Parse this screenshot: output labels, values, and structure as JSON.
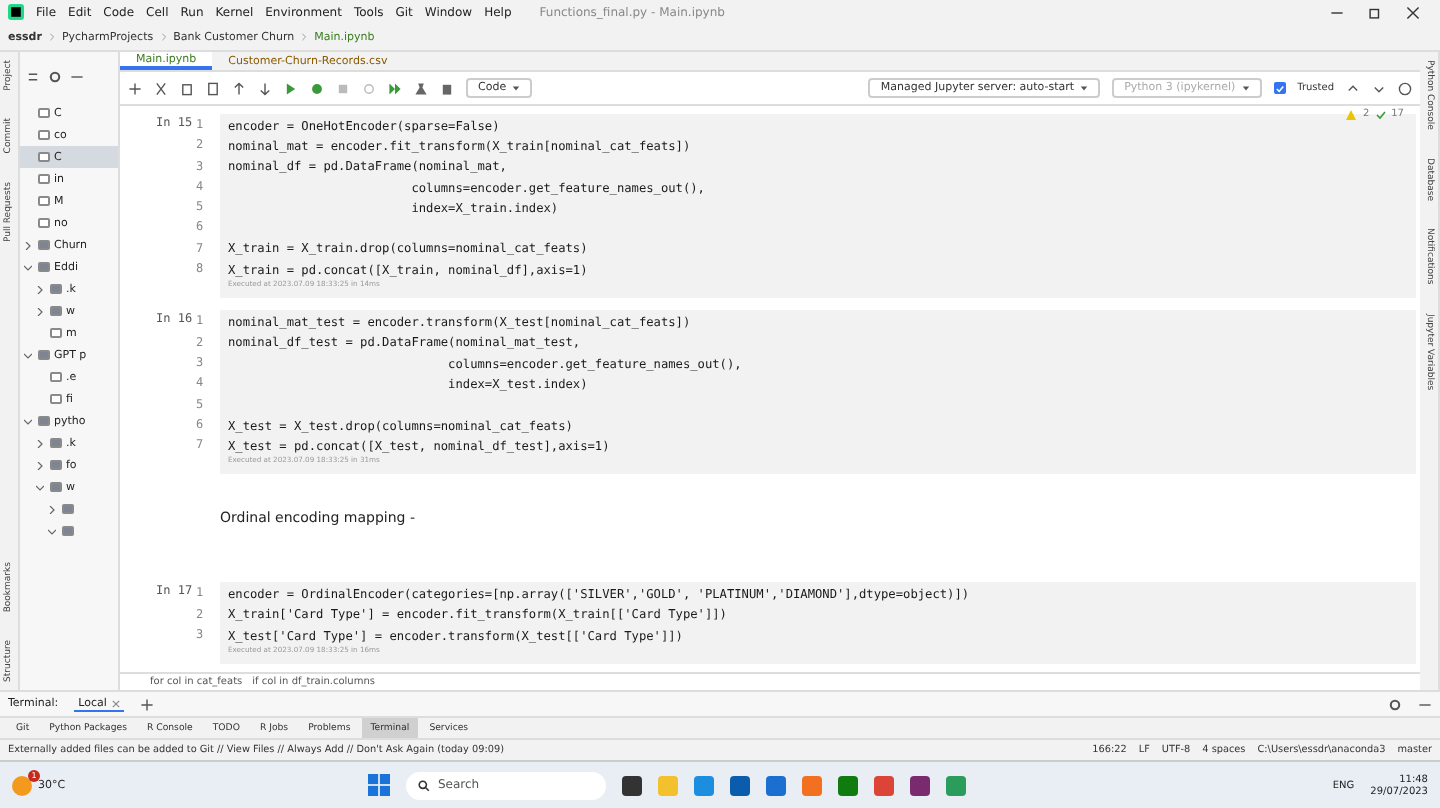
{
  "menu": [
    "File",
    "Edit",
    "Code",
    "Cell",
    "Run",
    "Kernel",
    "Environment",
    "Tools",
    "Git",
    "Window",
    "Help"
  ],
  "window": {
    "title": "Functions_final.py - Main.ipynb"
  },
  "breadcrumb": [
    "essdr",
    "PycharmProjects",
    "Bank Customer Churn",
    "Main.ipynb"
  ],
  "left_tool_tabs": [
    "Project",
    "Commit",
    "Pull Requests",
    "Bookmarks",
    "Structure"
  ],
  "project_tree": [
    {
      "label": "C",
      "kind": "file",
      "selected": false
    },
    {
      "label": "co",
      "kind": "file",
      "selected": false
    },
    {
      "label": "C",
      "kind": "file",
      "selected": true
    },
    {
      "label": "in",
      "kind": "file",
      "selected": false
    },
    {
      "label": "M",
      "kind": "file",
      "selected": false
    },
    {
      "label": "no",
      "kind": "file",
      "selected": false
    },
    {
      "label": "Churn",
      "kind": "folder",
      "selected": false,
      "expanded": false
    },
    {
      "label": "Eddi",
      "kind": "folder",
      "selected": false,
      "expanded": true,
      "children": [
        {
          "label": ".k",
          "kind": "folder",
          "selected": false,
          "expanded": false
        },
        {
          "label": "w",
          "kind": "folder",
          "selected": false,
          "expanded": false
        },
        {
          "label": "m",
          "kind": "file",
          "selected": false
        }
      ]
    },
    {
      "label": "GPT p",
      "kind": "folder",
      "selected": false,
      "expanded": true,
      "children": [
        {
          "label": ".e",
          "kind": "file",
          "selected": false
        },
        {
          "label": "fi",
          "kind": "file",
          "selected": false
        }
      ]
    },
    {
      "label": "pytho",
      "kind": "folder",
      "selected": false,
      "expanded": true,
      "children": [
        {
          "label": ".k",
          "kind": "folder",
          "selected": false,
          "expanded": false
        },
        {
          "label": "fo",
          "kind": "folder",
          "selected": false,
          "expanded": false
        },
        {
          "label": "w",
          "kind": "folder",
          "selected": false,
          "expanded": true,
          "children": [
            {
              "kind": "folder",
              "selected": false,
              "expanded": false
            },
            {
              "kind": "folder",
              "selected": false,
              "expanded": true
            }
          ]
        }
      ]
    }
  ],
  "editor_tabs": [
    {
      "label": "Main.ipynb",
      "selected": true
    },
    {
      "label": "Customer-Churn-Records.csv",
      "selected": false
    }
  ],
  "toolbar": {
    "cell_type": "Code",
    "server": "Managed Jupyter server: auto-start",
    "kernel": "Python 3 (ipykernel)",
    "trusted": true,
    "trusted_label": "Trusted"
  },
  "inspections": {
    "warnings": "2",
    "ok": "17"
  },
  "cells": [
    {
      "kind": "code",
      "prompt": "In 15",
      "lines": [
        {
          "n": "1",
          "code": "encoder = OneHotEncoder(sparse=False)"
        },
        {
          "n": "2",
          "code": "nominal_mat = encoder.fit_transform(X_train[nominal_cat_feats])"
        },
        {
          "n": "3",
          "code": "nominal_df = pd.DataFrame(nominal_mat,"
        },
        {
          "n": "4",
          "code": "                         columns=encoder.get_feature_names_out(),"
        },
        {
          "n": "5",
          "code": "                         index=X_train.index)"
        },
        {
          "n": "6"
        },
        {
          "n": "7",
          "code": "X_train = X_train.drop(columns=nominal_cat_feats)"
        },
        {
          "n": "8",
          "code": "X_train = pd.concat([X_train, nominal_df],axis=1)"
        }
      ],
      "status": "Executed at 2023.07.09 18:33:25 in 14ms"
    },
    {
      "kind": "code",
      "prompt": "In 16",
      "lines": [
        {
          "n": "1",
          "code": "nominal_mat_test = encoder.transform(X_test[nominal_cat_feats])"
        },
        {
          "n": "2",
          "code": "nominal_df_test = pd.DataFrame(nominal_mat_test,"
        },
        {
          "n": "3",
          "code": "                              columns=encoder.get_feature_names_out(),"
        },
        {
          "n": "4",
          "code": "                              index=X_test.index)"
        },
        {
          "n": "5"
        },
        {
          "n": "6",
          "code": "X_test = X_test.drop(columns=nominal_cat_feats)"
        },
        {
          "n": "7",
          "code": "X_test = pd.concat([X_test, nominal_df_test],axis=1)"
        }
      ],
      "status": "Executed at 2023.07.09 18:33:25 in 31ms"
    },
    {
      "kind": "markdown",
      "text": "Ordinal encoding mapping -"
    },
    {
      "kind": "code",
      "prompt": "In 17",
      "lines": [
        {
          "n": "1",
          "code": "encoder = OrdinalEncoder(categories=[np.array(['SILVER','GOLD', 'PLATINUM','DIAMOND'],dtype=object)])"
        },
        {
          "n": "2",
          "code": "X_train['Card Type'] = encoder.fit_transform(X_train[['Card Type']])"
        },
        {
          "n": "3",
          "code": "X_test['Card Type'] = encoder.transform(X_test[['Card Type']])"
        }
      ],
      "status": "Executed at 2023.07.09 18:33:25 in 16ms"
    }
  ],
  "code_breadcrumb": [
    "for col in cat_feats",
    "if col in df_train.columns"
  ],
  "right_tool_tabs": [
    "Python Console",
    "Database",
    "Notifications",
    "Jupyter Variables"
  ],
  "terminal": {
    "title": "Terminal:",
    "tab": "Local"
  },
  "tool_windows": [
    {
      "label": "Git",
      "selected": false
    },
    {
      "label": "Python Packages",
      "selected": false
    },
    {
      "label": "R Console",
      "selected": false
    },
    {
      "label": "TODO",
      "selected": false
    },
    {
      "label": "R Jobs",
      "selected": false
    },
    {
      "label": "Problems",
      "selected": false
    },
    {
      "label": "Terminal",
      "selected": true
    },
    {
      "label": "Services",
      "selected": false
    }
  ],
  "status_bar": {
    "message": "Externally added files can be added to Git // View Files // Always Add // Don't Ask Again (today 09:09)",
    "position": "166:22",
    "line_sep": "LF",
    "encoding": "UTF-8",
    "indent": "4 spaces",
    "interpreter": "C:\\Users\\essdr\\anaconda3",
    "branch": "master"
  },
  "taskbar": {
    "temperature": "30°C",
    "weather_badge": "1",
    "search_placeholder": "Search",
    "language": "ENG",
    "time": "11:48",
    "date": "29/07/2023"
  }
}
